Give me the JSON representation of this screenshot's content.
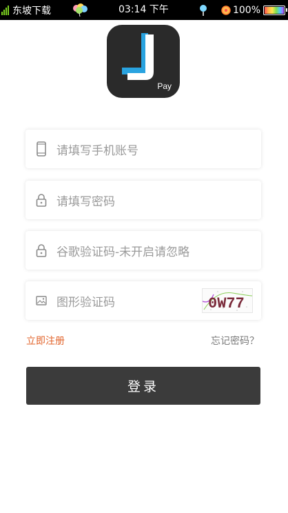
{
  "status_bar": {
    "carrier": "东坡下载",
    "time": "03:14 下午",
    "battery": "100%",
    "signal_color": "#7ed321"
  },
  "logo": {
    "brand_text": "Pay",
    "letter": "J",
    "accent_color": "#29a3e0"
  },
  "form": {
    "phone_placeholder": "请填写手机账号",
    "password_placeholder": "请填写密码",
    "google_code_placeholder": "谷歌验证码-未开启请忽略",
    "captcha_placeholder": "图形验证码",
    "captcha_image_text": "0W77"
  },
  "links": {
    "register": "立即注册",
    "forgot_password": "忘记密码？"
  },
  "login_button": "登录",
  "colors": {
    "link_orange": "#e2632a",
    "button_dark": "#3b3b3b",
    "placeholder_gray": "#9a9a9a"
  }
}
